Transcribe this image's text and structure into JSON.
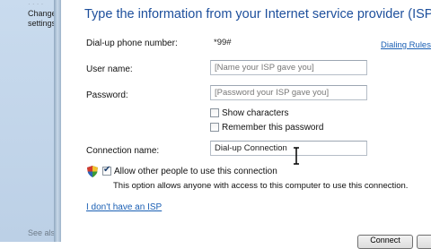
{
  "background_window": {
    "partial_lines": [
      "Change",
      "settings"
    ],
    "see_also": "See also"
  },
  "dialog": {
    "header": "Type the information from your Internet service provider (ISP)",
    "fields": [
      {
        "label": "Dial-up phone number:",
        "value": "*99#",
        "placeholder": ""
      },
      {
        "label": "User name:",
        "value": "",
        "placeholder": "[Name your ISP gave you]"
      },
      {
        "label": "Password:",
        "value": "",
        "placeholder": "[Password your ISP gave you]"
      },
      {
        "label": "Connection name:",
        "value": "Dial-up Connection",
        "placeholder": ""
      }
    ],
    "dialing_rules_link": "Dialing Rules",
    "checkboxes": {
      "show_characters": {
        "label": "Show characters",
        "checked": false
      },
      "remember_password": {
        "label": "Remember this password",
        "checked": false
      },
      "allow_others": {
        "label": "Allow other people to use this connection",
        "checked": true
      }
    },
    "allow_note": "This option allows anyone with access to this computer to use this connection.",
    "no_isp_link": "I don't have an ISP",
    "buttons": {
      "connect": "Connect"
    },
    "colors": {
      "header": "#1d4f9c",
      "link": "#1a5fb4"
    }
  }
}
